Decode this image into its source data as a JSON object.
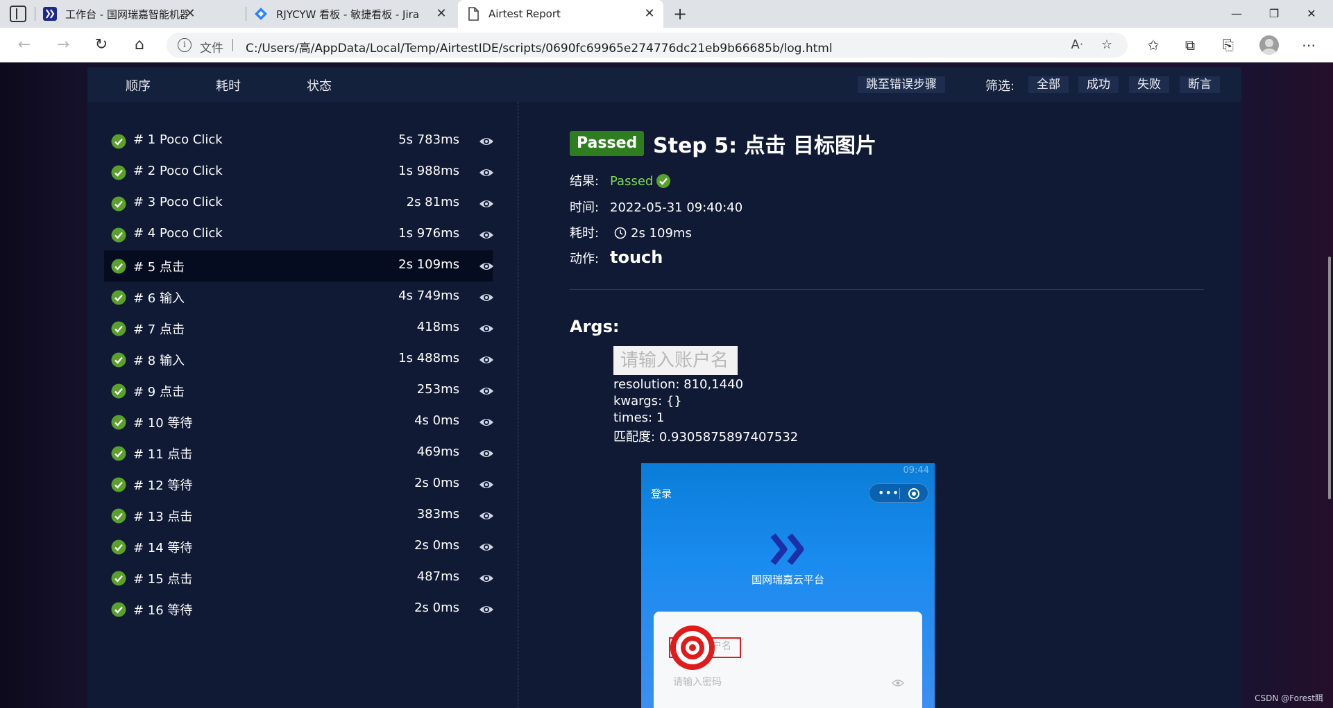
{
  "browser": {
    "tabs": [
      {
        "title": "工作台 - 国网瑞嘉智能机器人云平台",
        "active": false
      },
      {
        "title": "RJYCYW 看板 - 敏捷看板 - Jira",
        "active": false
      },
      {
        "title": "Airtest Report",
        "active": true
      }
    ],
    "address": {
      "label": "文件",
      "url": "C:/Users/高/AppData/Local/Temp/AirtestIDE/scripts/0690fc69965e274776dc21eb9b66685b/log.html"
    }
  },
  "report": {
    "toolbar": {
      "sort_order": "顺序",
      "sort_duration": "耗时",
      "sort_status": "状态",
      "jump_error": "跳至错误步骤",
      "filter_label": "筛选:",
      "filters": [
        "全部",
        "成功",
        "失败",
        "断言"
      ]
    },
    "steps": [
      {
        "name": "# 1 Poco Click",
        "duration": "5s 783ms"
      },
      {
        "name": "# 2 Poco Click",
        "duration": "1s 988ms"
      },
      {
        "name": "# 3 Poco Click",
        "duration": "2s 81ms"
      },
      {
        "name": "# 4 Poco Click",
        "duration": "1s 976ms"
      },
      {
        "name": "# 5 点击",
        "duration": "2s 109ms"
      },
      {
        "name": "# 6 输入",
        "duration": "4s 749ms"
      },
      {
        "name": "# 7 点击",
        "duration": "418ms"
      },
      {
        "name": "# 8 输入",
        "duration": "1s 488ms"
      },
      {
        "name": "# 9 点击",
        "duration": "253ms"
      },
      {
        "name": "# 10 等待",
        "duration": "4s 0ms"
      },
      {
        "name": "# 11 点击",
        "duration": "469ms"
      },
      {
        "name": "# 12 等待",
        "duration": "2s 0ms"
      },
      {
        "name": "# 13 点击",
        "duration": "383ms"
      },
      {
        "name": "# 14 等待",
        "duration": "2s 0ms"
      },
      {
        "name": "# 15 点击",
        "duration": "487ms"
      },
      {
        "name": "# 16 等待",
        "duration": "2s 0ms"
      }
    ],
    "active_step_index": 4,
    "detail": {
      "badge": "Passed",
      "title": "Step 5: 点击 目标图片",
      "result_label": "结果:",
      "result_value": "Passed",
      "time_label": "时间:",
      "time_value": "2022-05-31 09:40:40",
      "duration_label": "耗时:",
      "duration_value": "2s 109ms",
      "action_label": "动作:",
      "action_value": "touch",
      "args_title": "Args:",
      "arg_image_text": "请输入账户名",
      "resolution": "resolution: 810,1440",
      "kwargs": "kwargs: {}",
      "times": "times: 1",
      "match_label": "匹配度:",
      "match_value": "0.9305875897407532"
    },
    "phone": {
      "status_time": "09:44",
      "login_title": "登录",
      "platform_name": "国网瑞嘉云平台",
      "username_placeholder": "请输入账户名",
      "password_placeholder": "请输入密码"
    }
  },
  "watermark": "CSDN @Forest眲",
  "colors": {
    "report_bg": "#101a35",
    "nav_bg": "#14213d",
    "passed_badge": "#2e7d1f",
    "passed_text": "#7ed957",
    "check": "#5aa02c"
  }
}
